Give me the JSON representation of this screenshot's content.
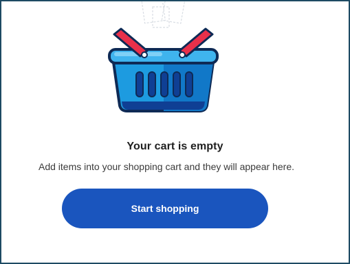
{
  "empty_cart": {
    "illustration_icon": "shopping-basket-icon",
    "title": "Your cart is empty",
    "message": "Add items into your shopping cart and they will appear here.",
    "cta_label": "Start shopping"
  },
  "colors": {
    "border": "#1d4a63",
    "button": "#1a55be",
    "basket_blue": "#1d9be0",
    "basket_dark": "#0f3f94",
    "handle_red": "#e8304a"
  }
}
